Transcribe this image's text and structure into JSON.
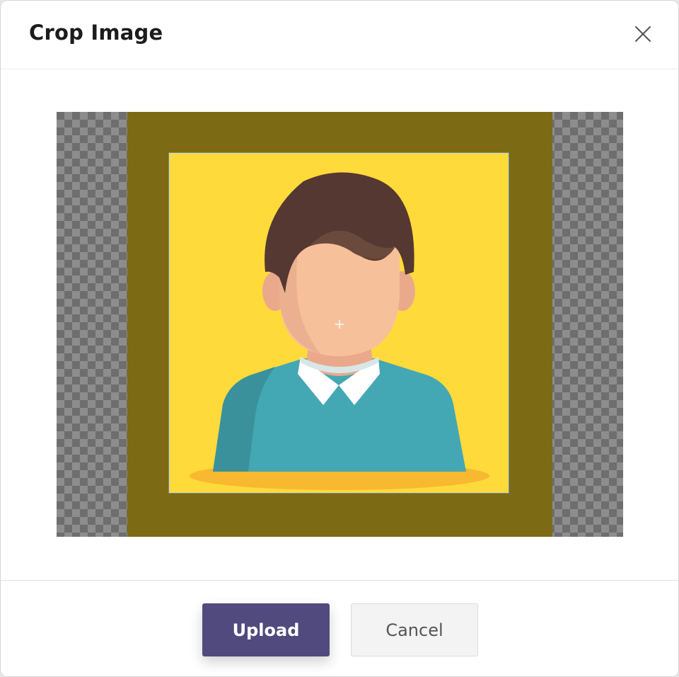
{
  "dialog": {
    "title": "Crop Image",
    "close_icon": "close-icon"
  },
  "cropper": {
    "image_subject": "avatar-illustration",
    "colors": {
      "transparent_a": "#6e6e6e",
      "transparent_b": "#8d8d8d",
      "overlay": "#7d6a14",
      "image_bg": "#ffda3a",
      "selection_border": "#5b8ec7"
    }
  },
  "footer": {
    "upload_label": "Upload",
    "cancel_label": "Cancel",
    "upload_color": "#514a7e"
  }
}
